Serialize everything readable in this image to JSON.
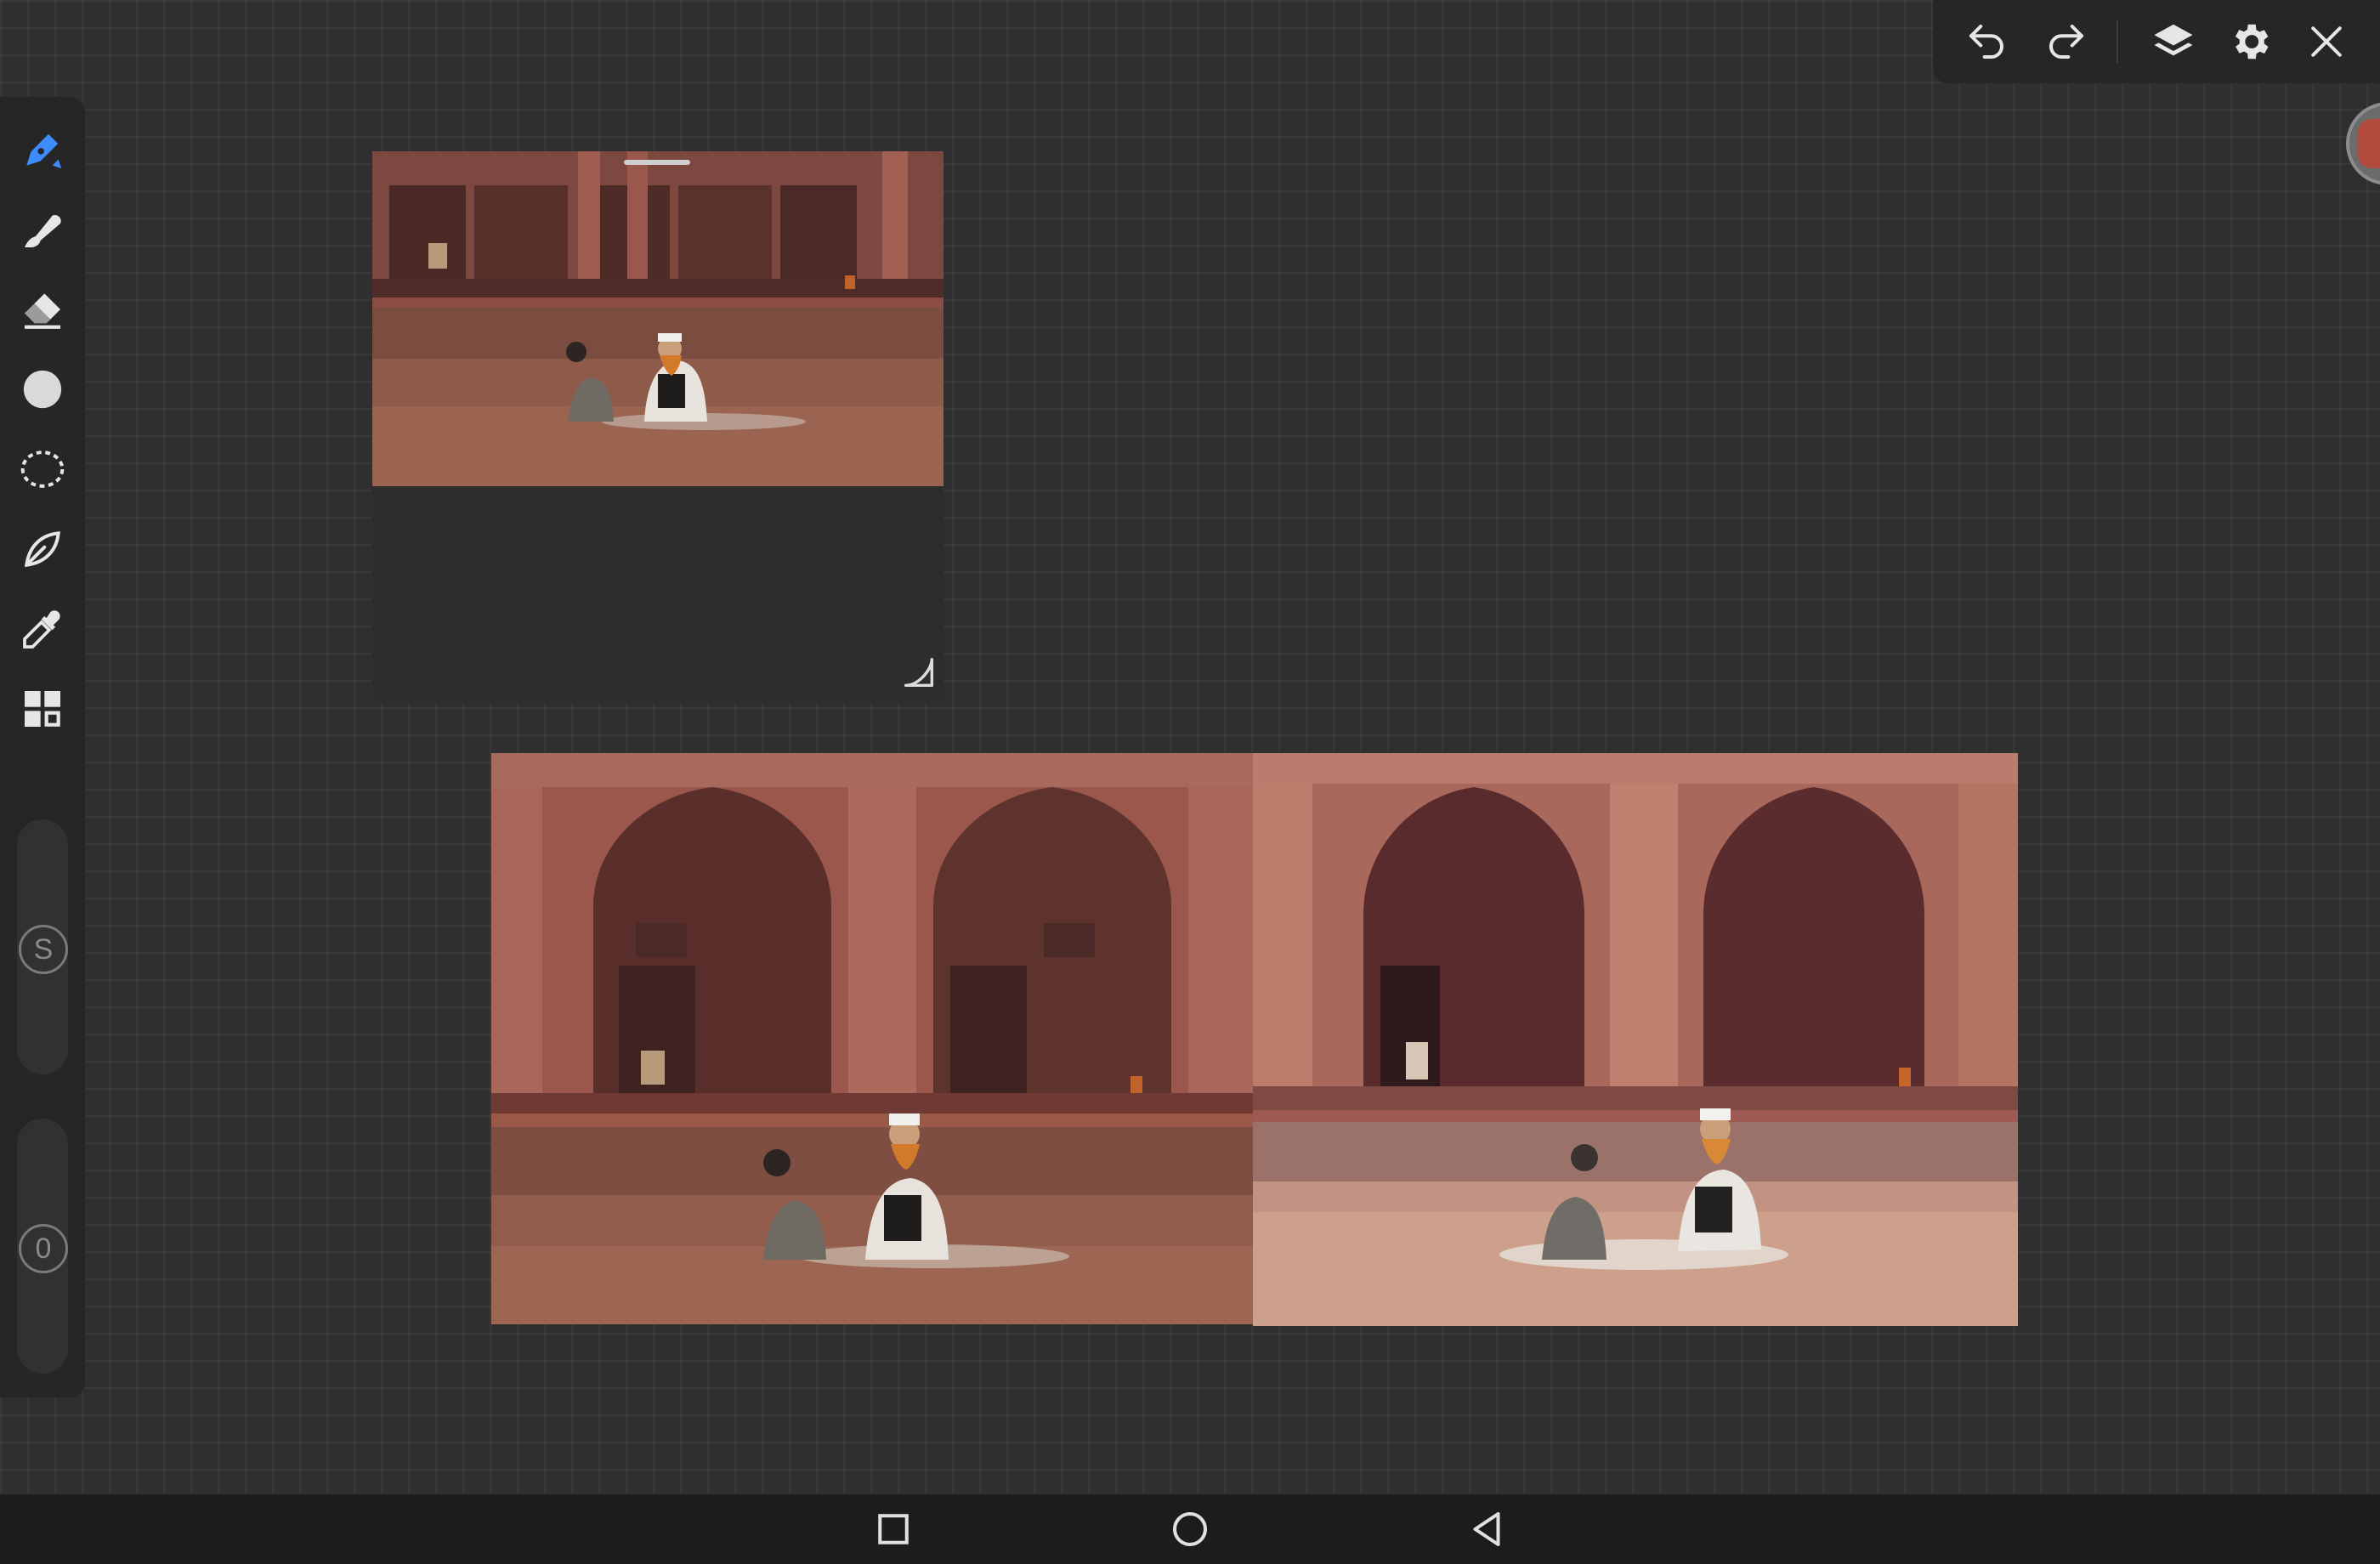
{
  "app": {
    "accent_color": "#3d8bfd",
    "icon_color": "#e6e6e6",
    "background_color": "#2f2f2f"
  },
  "top_toolbar": {
    "buttons": [
      "undo-icon",
      "redo-icon",
      "layers-icon",
      "gear-icon",
      "close-icon"
    ]
  },
  "tool_rail": {
    "tools": [
      "pen-tool-icon",
      "smudge-tool-icon",
      "eraser-tool-icon",
      "color-swatch-icon",
      "lasso-select-icon",
      "shape-tool-icon",
      "eyedropper-icon",
      "gallery-grid-icon"
    ],
    "active_tool": "pen-tool-icon",
    "size_slider_label": "S",
    "opacity_slider_label": "0"
  },
  "reference_panel": {
    "image": "reference-photo"
  },
  "canvas": {
    "left_image": "source-photo",
    "right_image": "painted-study"
  },
  "nav_bar": {
    "buttons": [
      "recent-apps-icon",
      "home-icon",
      "back-icon"
    ]
  }
}
